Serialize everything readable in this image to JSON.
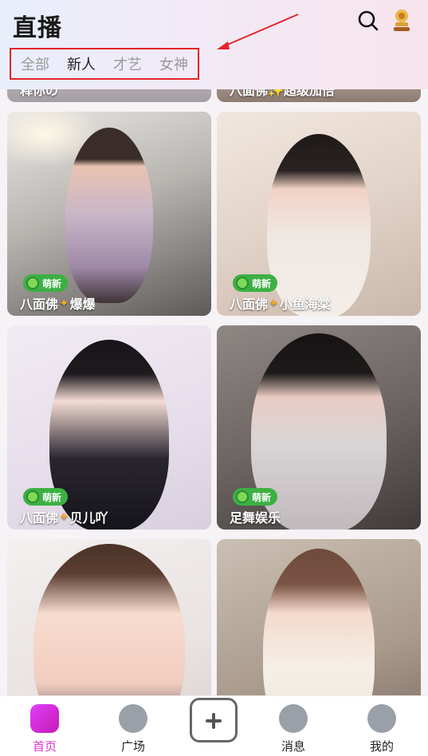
{
  "header": {
    "title": "直播",
    "tabs": [
      {
        "label": "全部",
        "active": false
      },
      {
        "label": "新人",
        "active": true
      },
      {
        "label": "才艺",
        "active": false
      },
      {
        "label": "女神",
        "active": false
      }
    ],
    "icons": [
      "search-icon",
      "trophy-avatar-icon"
    ],
    "annotation_color": "#e3242b"
  },
  "partial_cards": {
    "left_name": "释你の",
    "right_name": "八面佛✨超级加倍"
  },
  "cards": [
    {
      "badge": "萌新",
      "name_prefix": "八面佛",
      "name_suffix": "爆爆"
    },
    {
      "badge": "萌新",
      "name_prefix": "八面佛",
      "name_suffix": "小鱼海棠"
    },
    {
      "badge": "萌新",
      "name_prefix": "八面佛",
      "name_suffix": "贝儿吖"
    },
    {
      "badge": "萌新",
      "name_prefix": "足舞娱乐",
      "name_suffix": ""
    },
    {
      "badge": "",
      "name_prefix": "",
      "name_suffix": ""
    },
    {
      "badge": "",
      "name_prefix": "",
      "name_suffix": ""
    }
  ],
  "nav": {
    "home": "首页",
    "square": "广场",
    "messages": "消息",
    "profile": "我的"
  },
  "colors": {
    "accent": "#d935c8",
    "badge_green": "#3cb043"
  }
}
